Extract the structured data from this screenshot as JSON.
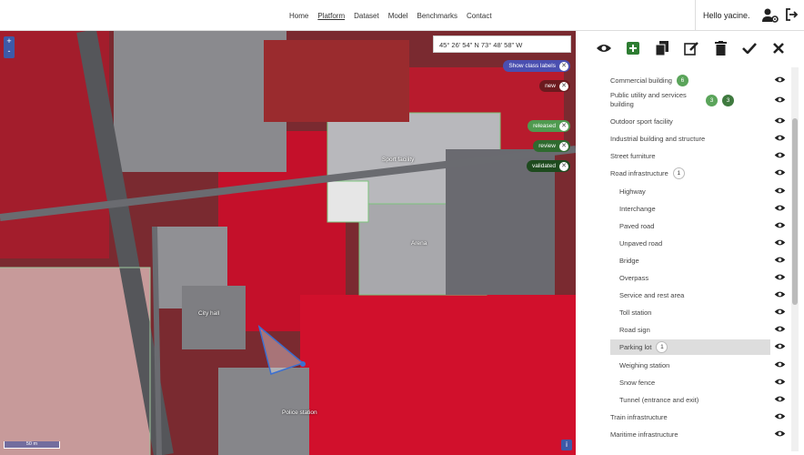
{
  "nav": {
    "items": [
      "Home",
      "Platform",
      "Dataset",
      "Model",
      "Benchmarks",
      "Contact"
    ],
    "active": "Platform"
  },
  "user": {
    "greeting": "Hello yacine.",
    "settings_icon": "user-gear-icon",
    "logout_icon": "sign-out-icon"
  },
  "map": {
    "zoom_plus": "+",
    "zoom_minus": "-",
    "coordinates": "45° 26' 54\" N 73° 48' 58\" W",
    "chips": [
      {
        "label": "Show class labels",
        "color": "#4a4fb0"
      },
      {
        "label": "new",
        "color": "#6b1a1e"
      },
      {
        "label": "released",
        "color": "#4f9a4f"
      },
      {
        "label": "review",
        "color": "#2f6a2f"
      },
      {
        "label": "validated",
        "color": "#1e4a1e"
      }
    ],
    "labels": [
      "Sport facility",
      "Arena",
      "City hall",
      "Police station"
    ],
    "scale": "50 m",
    "info": "i"
  },
  "toolbar": [
    "view-icon",
    "add-icon",
    "copy-icon",
    "edit-icon",
    "delete-icon",
    "check-icon",
    "close-icon"
  ],
  "classes": [
    {
      "label": "Commercial building",
      "badges": [
        {
          "text": "6",
          "style": "green"
        }
      ],
      "sub": false
    },
    {
      "label": "Public utility and services building",
      "badges": [
        {
          "text": "3",
          "style": "green"
        },
        {
          "text": "3",
          "style": "dark"
        }
      ],
      "sub": false
    },
    {
      "label": "Outdoor sport facility",
      "badges": [],
      "sub": false
    },
    {
      "label": "Industrial building and structure",
      "badges": [],
      "sub": false
    },
    {
      "label": "Street furniture",
      "badges": [],
      "sub": false
    },
    {
      "label": "Road infrastructure",
      "badges": [
        {
          "text": "1",
          "style": "white"
        }
      ],
      "sub": false
    },
    {
      "label": "Highway",
      "badges": [],
      "sub": true
    },
    {
      "label": "Interchange",
      "badges": [],
      "sub": true
    },
    {
      "label": "Paved road",
      "badges": [],
      "sub": true
    },
    {
      "label": "Unpaved road",
      "badges": [],
      "sub": true
    },
    {
      "label": "Bridge",
      "badges": [],
      "sub": true
    },
    {
      "label": "Overpass",
      "badges": [],
      "sub": true
    },
    {
      "label": "Service and rest area",
      "badges": [],
      "sub": true
    },
    {
      "label": "Toll station",
      "badges": [],
      "sub": true
    },
    {
      "label": "Road sign",
      "badges": [],
      "sub": true
    },
    {
      "label": "Parking lot",
      "badges": [
        {
          "text": "1",
          "style": "white"
        }
      ],
      "sub": true,
      "selected": true
    },
    {
      "label": "Weighing station",
      "badges": [],
      "sub": true
    },
    {
      "label": "Snow fence",
      "badges": [],
      "sub": true
    },
    {
      "label": "Tunnel (entrance and exit)",
      "badges": [],
      "sub": true
    },
    {
      "label": "Train infrastructure",
      "badges": [],
      "sub": false
    },
    {
      "label": "Maritime infrastructure",
      "badges": [],
      "sub": false
    }
  ]
}
